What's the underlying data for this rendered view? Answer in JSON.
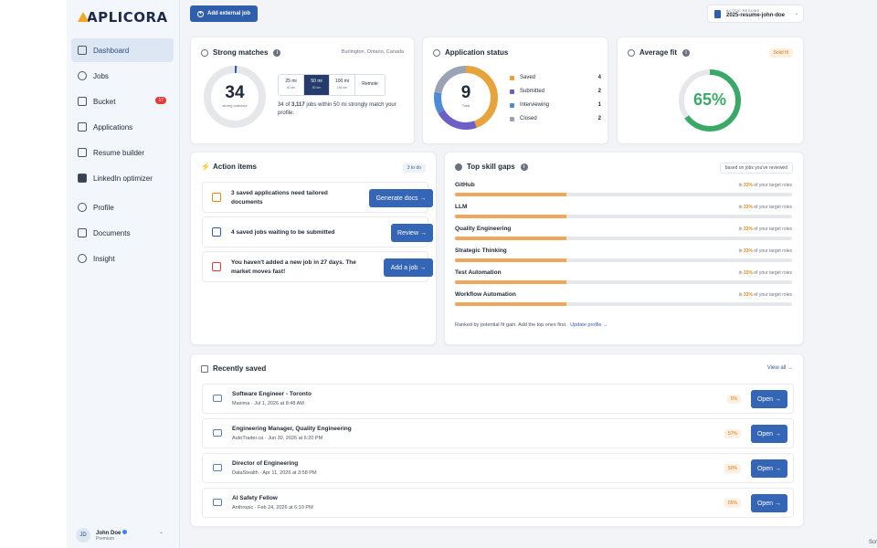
{
  "brand": {
    "name": "APLICORA"
  },
  "sidebar": {
    "items": [
      {
        "label": "Dashboard",
        "icon": "dashboard-icon",
        "active": true
      },
      {
        "label": "Jobs",
        "icon": "search-icon"
      },
      {
        "label": "Bucket",
        "icon": "bucket-icon",
        "badge": "17"
      },
      {
        "label": "Applications",
        "icon": "folder-icon"
      },
      {
        "label": "Resume builder",
        "icon": "document-icon"
      },
      {
        "label": "LinkedIn optimizer",
        "icon": "linkedin-icon"
      },
      {
        "label": "Profile",
        "icon": "user-icon"
      },
      {
        "label": "Documents",
        "icon": "folder-icon"
      },
      {
        "label": "Insight",
        "icon": "lightbulb-icon"
      }
    ],
    "user": {
      "initials": "JD",
      "name": "John Doe",
      "plan": "Premium"
    }
  },
  "topbar": {
    "add_job_label": "Add external job",
    "resume_label": "ACTIVE RESUME",
    "resume_value": "2025-resume-john-doe"
  },
  "strong_matches": {
    "title": "Strong matches",
    "location": "Burlington, Ontario, Canada",
    "count": "34",
    "count_label": "strong matches",
    "ring_fraction": 0.011,
    "radius_options": [
      {
        "label": "25 mi",
        "km": "40 km"
      },
      {
        "label": "50 mi",
        "km": "80 km",
        "selected": true
      },
      {
        "label": "100 mi",
        "km": "161 km"
      },
      {
        "label": "Remote",
        "km": ""
      }
    ],
    "summary_prefix": "34 of ",
    "summary_total": "3,117",
    "summary_suffix": " jobs within 50 mi strongly match your profile."
  },
  "application_status": {
    "title": "Application status",
    "total": "9",
    "total_label": "Total",
    "rows": [
      {
        "label": "Saved",
        "count": "4",
        "color": "#e8a33a"
      },
      {
        "label": "Submitted",
        "count": "2",
        "color": "#6c5fc7"
      },
      {
        "label": "Interviewing",
        "count": "1",
        "color": "#4f8ad6"
      },
      {
        "label": "Closed",
        "count": "2",
        "color": "#9aa3b5"
      }
    ]
  },
  "average_fit": {
    "title": "Average fit",
    "badge": "Solid fit",
    "value": "65%",
    "fraction": 0.65,
    "color": "#3aa866"
  },
  "action_items": {
    "title": "Action items",
    "badge": "3 to do",
    "items": [
      {
        "text": "3 saved applications need tailored documents",
        "button": "Generate docs →",
        "icon": "document-icon"
      },
      {
        "text": "4 saved jobs waiting to be submitted",
        "button": "Review →",
        "icon": "send-icon"
      },
      {
        "text": "You haven't added a new job in 27 days. The market moves fast!",
        "button": "Add a job →",
        "icon": "calendar-icon"
      }
    ]
  },
  "skill_gaps": {
    "title": "Top skill gaps",
    "badge": "based on jobs you've reviewed",
    "skills": [
      {
        "name": "GitHub",
        "prefix": "in ",
        "pct": "33%",
        "suffix": " of your target roles",
        "fraction": 0.33
      },
      {
        "name": "LLM",
        "prefix": "in ",
        "pct": "33%",
        "suffix": " of your target roles",
        "fraction": 0.33
      },
      {
        "name": "Quality Engineering",
        "prefix": "in ",
        "pct": "33%",
        "suffix": " of your target roles",
        "fraction": 0.33
      },
      {
        "name": "Strategic Thinking",
        "prefix": "in ",
        "pct": "33%",
        "suffix": " of your target roles",
        "fraction": 0.33
      },
      {
        "name": "Test Automation",
        "prefix": "in ",
        "pct": "33%",
        "suffix": " of your target roles",
        "fraction": 0.33
      },
      {
        "name": "Workflow Automation",
        "prefix": "in ",
        "pct": "33%",
        "suffix": " of your target roles",
        "fraction": 0.33
      }
    ],
    "footer": "Ranked by potential fit gain. Add the top ones first.",
    "footer_link": "Update profile →"
  },
  "recently_saved": {
    "title": "Recently saved",
    "view_all": "View all →",
    "open_label": "Open →",
    "jobs": [
      {
        "title": "Software Engineer - Toronto",
        "meta": "Maxima · Jul 1, 2026 at 8:48 AM",
        "fit": "0%"
      },
      {
        "title": "Engineering Manager, Quality Engineering",
        "meta": "AutoTrader.ca · Jun 30, 2026 at 6:20 PM",
        "fit": "57%"
      },
      {
        "title": "Director of Engineering",
        "meta": "DataStealth · Apr 11, 2026 at 3:58 PM",
        "fit": "50%"
      },
      {
        "title": "AI Safety Fellow",
        "meta": "Anthropic · Feb 24, 2026 at 6:10 PM",
        "fit": "65%"
      }
    ]
  },
  "scroll_hint": "Scr"
}
